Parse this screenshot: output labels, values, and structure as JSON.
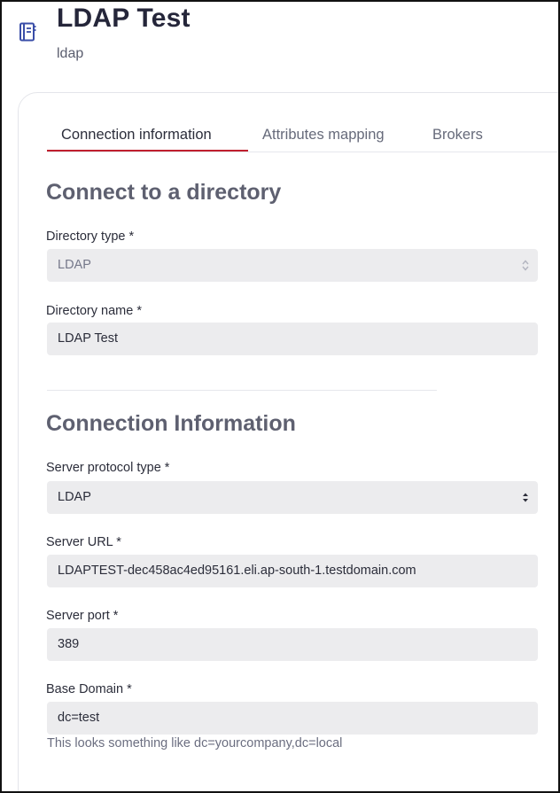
{
  "header": {
    "title": "LDAP Test",
    "subtitle": "ldap",
    "icon": "directory-book-icon"
  },
  "tabs": [
    {
      "label": "Connection information",
      "active": true
    },
    {
      "label": "Attributes mapping",
      "active": false
    },
    {
      "label": "Brokers",
      "active": false
    }
  ],
  "accent_color": "#c0202e",
  "connect_section": {
    "title": "Connect to a directory",
    "directory_type": {
      "label": "Directory type *",
      "value": "LDAP",
      "disabled": true
    },
    "directory_name": {
      "label": "Directory name *",
      "value": "LDAP Test"
    }
  },
  "connection_section": {
    "title": "Connection Information",
    "protocol": {
      "label": "Server protocol type *",
      "value": "LDAP"
    },
    "server_url": {
      "label": "Server URL *",
      "value": "LDAPTEST-dec458ac4ed95161.eli.ap-south-1.testdomain.com"
    },
    "server_port": {
      "label": "Server port *",
      "value": "389"
    },
    "base_domain": {
      "label": "Base Domain *",
      "value": "dc=test",
      "hint": "This looks something like dc=yourcompany,dc=local"
    }
  }
}
